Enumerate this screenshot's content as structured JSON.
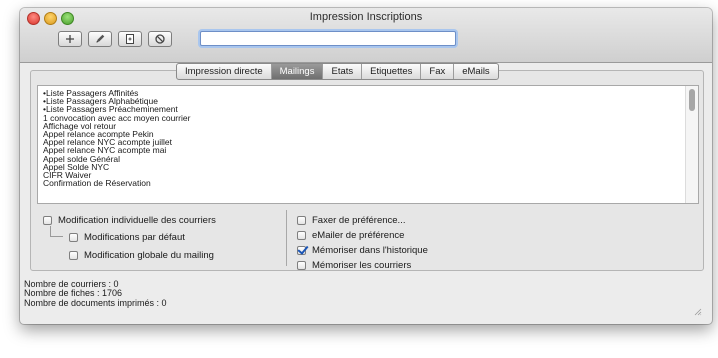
{
  "window": {
    "title": "Impression Inscriptions"
  },
  "toolbar": {
    "buttons": [
      {
        "name": "add-button",
        "icon": "plus-icon"
      },
      {
        "name": "edit-button",
        "icon": "pencil-icon"
      },
      {
        "name": "import-button",
        "icon": "document-add-icon"
      },
      {
        "name": "cancel-button",
        "icon": "no-entry-icon"
      }
    ],
    "search_value": ""
  },
  "tabs": [
    {
      "label": "Impression directe",
      "active": false
    },
    {
      "label": "Mailings",
      "active": true
    },
    {
      "label": "Etats",
      "active": false
    },
    {
      "label": "Etiquettes",
      "active": false
    },
    {
      "label": "Fax",
      "active": false
    },
    {
      "label": "eMails",
      "active": false
    }
  ],
  "list": {
    "items": [
      "•Liste Passagers Affinités",
      "•Liste Passagers Alphabétique",
      "•Liste Passagers Préacheminement",
      "1 convocation avec acc moyen courrier",
      "Affichage vol retour",
      "Appel relance acompte Pekin",
      "Appel relance NYC acompte juillet",
      "Appel relance NYC acompte mai",
      "Appel solde Général",
      "Appel Solde NYC",
      "CIFR Waiver",
      "Confirmation de Réservation"
    ]
  },
  "options": {
    "left": [
      {
        "label": "Modification individuelle des courriers",
        "checked": false
      },
      {
        "label": "Modifications par défaut",
        "checked": false
      },
      {
        "label": "Modification globale du mailing",
        "checked": false
      }
    ],
    "right": [
      {
        "label": "Faxer de préférence...",
        "checked": false
      },
      {
        "label": "eMailer de préférence",
        "checked": false
      },
      {
        "label": "Mémoriser dans l'historique",
        "checked": true
      },
      {
        "label": "Mémoriser les courriers",
        "checked": false
      }
    ]
  },
  "status": {
    "courriers": "Nombre de courriers : 0",
    "fiches": "Nombre de fiches : 1706",
    "documents": "Nombre de documents imprimés : 0"
  },
  "colors": {
    "active_tab": "#7f7f7f",
    "focus_ring": "#a9c6ee",
    "checkmark": "#1b55b5"
  }
}
